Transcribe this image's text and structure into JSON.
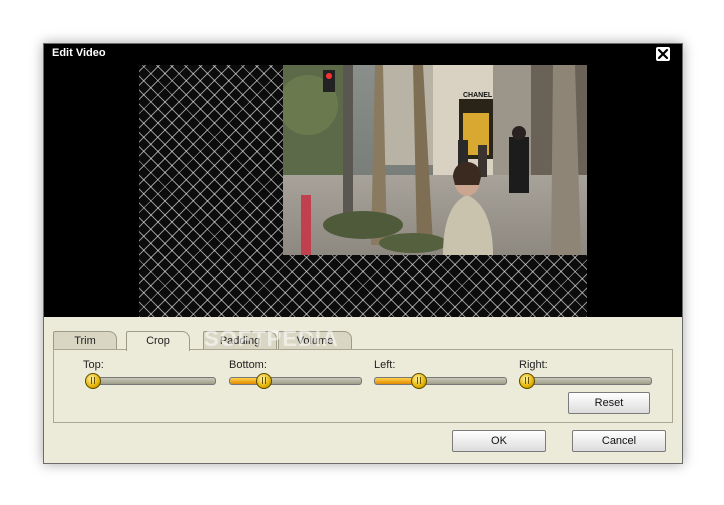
{
  "window": {
    "title": "Edit Video"
  },
  "icons": {
    "close": "close-x-icon"
  },
  "preview": {
    "video_sign": "CHANEL"
  },
  "tabs": [
    {
      "label": "Trim",
      "active": false
    },
    {
      "label": "Crop",
      "active": true
    },
    {
      "label": "Padding",
      "active": false
    },
    {
      "label": "Volume",
      "active": false
    }
  ],
  "watermark": "SOFTPEDIA",
  "crop": {
    "top": {
      "label": "Top:",
      "value": 0
    },
    "bottom": {
      "label": "Bottom:",
      "value": 0.25
    },
    "left": {
      "label": "Left:",
      "value": 0.33
    },
    "right": {
      "label": "Right:",
      "value": 0
    },
    "reset_label": "Reset"
  },
  "footer": {
    "ok_label": "OK",
    "cancel_label": "Cancel"
  },
  "colors": {
    "accent": "#f0a400",
    "panel": "#ecead9",
    "titlebar": "#000000"
  }
}
